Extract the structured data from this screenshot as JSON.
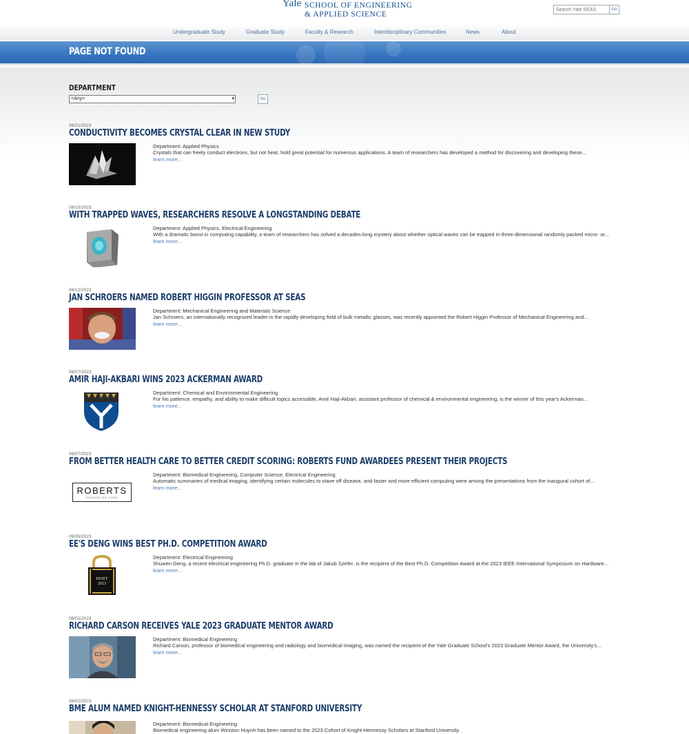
{
  "header": {
    "logo_yale": "Yale",
    "logo_line1": "SCHOOL OF ENGINEERING",
    "logo_line2": "& APPLIED SCIENCE",
    "search_placeholder": "Search Yale SEAS",
    "search_button": "Go"
  },
  "nav": {
    "items": [
      {
        "label": "Undergraduate Study"
      },
      {
        "label": "Graduate Study"
      },
      {
        "label": "Faculty & Research"
      },
      {
        "label": "Interdisciplinary Communities"
      },
      {
        "label": "News"
      },
      {
        "label": "About"
      }
    ]
  },
  "banner": {
    "title": "PAGE NOT FOUND"
  },
  "filter": {
    "label": "DEPARTMENT",
    "selected": "<Any>",
    "go_label": "Go"
  },
  "news": [
    {
      "date": "06/21/2023",
      "title": "CONDUCTIVITY BECOMES CRYSTAL CLEAR IN NEW STUDY",
      "department": "Department: Applied Physics",
      "summary": "Crystals that can freely conduct electrons, but not heat, hold great potential for numerous applications. A team of researchers has developed a method for discovering and developing these...",
      "more": "learn more...",
      "thumb_icon": "crystal-image"
    },
    {
      "date": "06/15/2023",
      "title": "WITH TRAPPED WAVES, RESEARCHERS RESOLVE A LONGSTANDING DEBATE",
      "department": "Department: Applied Physics, Electrical Engineering",
      "summary": "With a dramatic boost in computing capability, a team of researchers has solved a decades-long mystery about whether optical waves can be trapped in three-dimensional randomly packed micro- or...",
      "more": "learn more...",
      "thumb_icon": "cube-image"
    },
    {
      "date": "06/12/2023",
      "title": "JAN SCHROERS NAMED ROBERT HIGGIN PROFESSOR AT SEAS",
      "department": "Department: Mechanical Engineering and Materials Science",
      "summary": "Jan Schroers, an internationally recognized leader in the rapidly developing field of bulk metallic glasses, was recently appointed the Robert Higgin Professor of Mechanical Engineering and...",
      "more": "learn more...",
      "thumb_icon": "portrait-photo"
    },
    {
      "date": "06/07/2023",
      "title": "AMIR HAJI-AKBARI WINS 2023 ACKERMAN AWARD",
      "department": "Department: Chemical and Environmental Engineering",
      "summary": "For his patience, empathy, and ability to make difficult topics accessible, Amir Haji-Akbari, assistant professor of chemical & environmental engineering, is the winner of this year's Ackerman...",
      "more": "learn more...",
      "thumb_icon": "shield-crest"
    },
    {
      "date": "06/07/2023",
      "title": "FROM BETTER HEALTH CARE TO BETTER CREDIT SCORING: ROBERTS FUND AWARDEES PRESENT THEIR PROJECTS",
      "department": "Department: Biomedical Engineering, Computer Science, Electrical Engineering",
      "summary": "Automatic summaries of medical imaging, identifying certain molecules to stave off disease, and faster and more efficient computing were among the presentations from the inaugural cohort of...",
      "more": "learn more...",
      "thumb_icon": "roberts-logo",
      "thumb_text": "ROBERTS",
      "thumb_subtext": "INNOVATION FUND"
    },
    {
      "date": "06/05/2023",
      "title": "EE'S DENG WINS BEST PH.D. COMPETITION AWARD",
      "department": "Department: Electrical Engineering",
      "summary": "Shuwen Deng, a recent electrical engineering Ph.D. graduate in the lab of Jakub Szefer, is the recipient of the Best Ph.D. Competition Award at the 2023 IEEE International Symposium on Hardware...",
      "more": "learn more...",
      "thumb_icon": "host-logo",
      "thumb_text": "HOST",
      "thumb_subtext": "2023"
    },
    {
      "date": "06/02/2023",
      "title": "RICHARD CARSON RECEIVES YALE 2023 GRADUATE MENTOR AWARD",
      "department": "Department: Biomedical Engineering",
      "summary": "Richard Carson, professor of biomedical engineering and radiology and biomedical imaging, was named the recipient of the Yale Graduate School's 2023 Graduate Mentor Award, the University's...",
      "more": "learn more...",
      "thumb_icon": "portrait-photo"
    },
    {
      "date": "06/02/2023",
      "title": "BME ALUM NAMED KNIGHT-HENNESSY SCHOLAR AT STANFORD UNIVERSITY",
      "department": "Department: Biomedical Engineering",
      "summary": "Biomedical engineering alum Winston Huynh has been named to the 2023 Cohort of Knight-Hennessy Scholars at Stanford University.",
      "more": "",
      "thumb_icon": "portrait-photo"
    }
  ]
}
